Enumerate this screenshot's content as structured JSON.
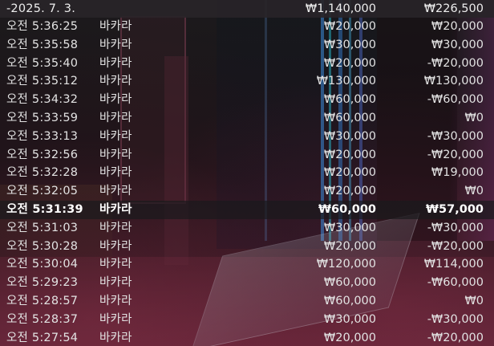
{
  "summary": {
    "date": "-2025. 7. 3.",
    "total_bet": "₩1,140,000",
    "total_result": "₩226,500"
  },
  "rows": [
    {
      "time": "오전 5:36:25",
      "game": "바카라",
      "bet": "₩20,000",
      "result": "₩20,000"
    },
    {
      "time": "오전 5:35:58",
      "game": "바카라",
      "bet": "₩30,000",
      "result": "₩30,000"
    },
    {
      "time": "오전 5:35:40",
      "game": "바카라",
      "bet": "₩20,000",
      "result": "-₩20,000"
    },
    {
      "time": "오전 5:35:12",
      "game": "바카라",
      "bet": "₩130,000",
      "result": "₩130,000"
    },
    {
      "time": "오전 5:34:32",
      "game": "바카라",
      "bet": "₩60,000",
      "result": "-₩60,000"
    },
    {
      "time": "오전 5:33:59",
      "game": "바카라",
      "bet": "₩60,000",
      "result": "₩0"
    },
    {
      "time": "오전 5:33:13",
      "game": "바카라",
      "bet": "₩30,000",
      "result": "-₩30,000"
    },
    {
      "time": "오전 5:32:56",
      "game": "바카라",
      "bet": "₩20,000",
      "result": "-₩20,000"
    },
    {
      "time": "오전 5:32:28",
      "game": "바카라",
      "bet": "₩20,000",
      "result": "₩19,000"
    },
    {
      "time": "오전 5:32:05",
      "game": "바카라",
      "bet": "₩20,000",
      "result": "₩0"
    },
    {
      "time": "오전 5:31:39",
      "game": "바카라",
      "bet": "₩60,000",
      "result": "₩57,000"
    },
    {
      "time": "오전 5:31:03",
      "game": "바카라",
      "bet": "₩30,000",
      "result": "-₩30,000"
    },
    {
      "time": "오전 5:30:28",
      "game": "바카라",
      "bet": "₩20,000",
      "result": "-₩20,000"
    },
    {
      "time": "오전 5:30:04",
      "game": "바카라",
      "bet": "₩120,000",
      "result": "₩114,000"
    },
    {
      "time": "오전 5:29:23",
      "game": "바카라",
      "bet": "₩60,000",
      "result": "-₩60,000"
    },
    {
      "time": "오전 5:28:57",
      "game": "바카라",
      "bet": "₩60,000",
      "result": "₩0"
    },
    {
      "time": "오전 5:28:37",
      "game": "바카라",
      "bet": "₩30,000",
      "result": "-₩30,000"
    },
    {
      "time": "오전 5:27:54",
      "game": "바카라",
      "bet": "₩20,000",
      "result": "-₩20,000"
    }
  ],
  "colors": {
    "text": "#e2e2e2",
    "highlight_text": "#ffffff",
    "date_row_bg": "#28242a"
  }
}
